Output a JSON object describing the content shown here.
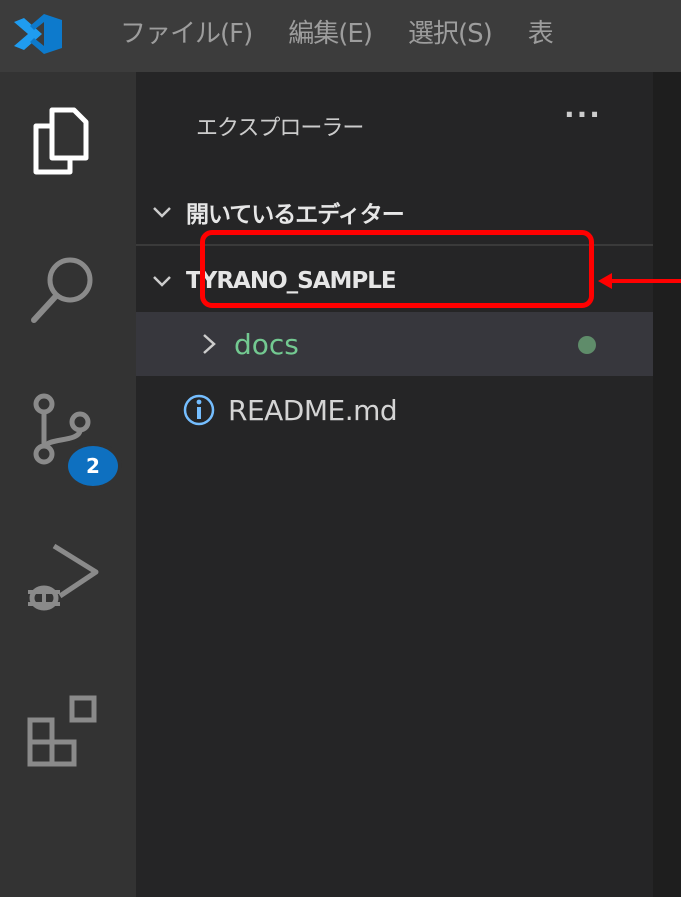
{
  "menu": {
    "items": [
      "ファイル(F)",
      "編集(E)",
      "選択(S)",
      "表"
    ]
  },
  "activity_bar": {
    "icons": [
      "files-icon",
      "search-icon",
      "source-control-icon",
      "run-debug-icon",
      "extensions-icon"
    ],
    "source_control_badge": "2"
  },
  "sidebar": {
    "title": "エクスプローラー",
    "more_label": "···",
    "sections": {
      "open_editors": "開いているエディター",
      "workspace": "TYRANO_SAMPLE"
    },
    "tree": [
      {
        "label": "docs",
        "type": "folder"
      },
      {
        "label": "README.md",
        "type": "file"
      }
    ]
  },
  "colors": {
    "highlight": "#ff0000",
    "folder_modified": "#73c991",
    "badge": "#0e70c0"
  }
}
